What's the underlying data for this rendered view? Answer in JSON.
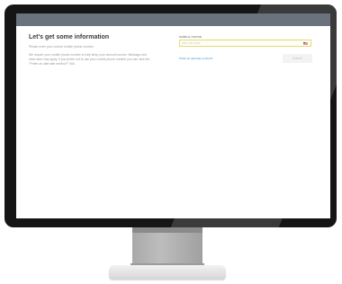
{
  "form": {
    "title": "Let's get some information",
    "subtitle": "Please enter your current mobile phone number.",
    "description": "We require your mobile phone number to help keep your account secure. Message and data rates may apply. If you prefer not to use your mobile phone number you can click the \"Prefer an alternate method?\" link.",
    "phone_label": "MOBILE PHONE",
    "phone_placeholder": "(555) 555-5555",
    "phone_value": "",
    "country_flag": "us-flag-icon",
    "alt_method_link": "Prefer an alternate method?",
    "submit_label": "Submit"
  },
  "colors": {
    "topbar": "#6a737d",
    "input_border": "#e5d96f",
    "link": "#3a86c8",
    "bezel": "#151515"
  }
}
